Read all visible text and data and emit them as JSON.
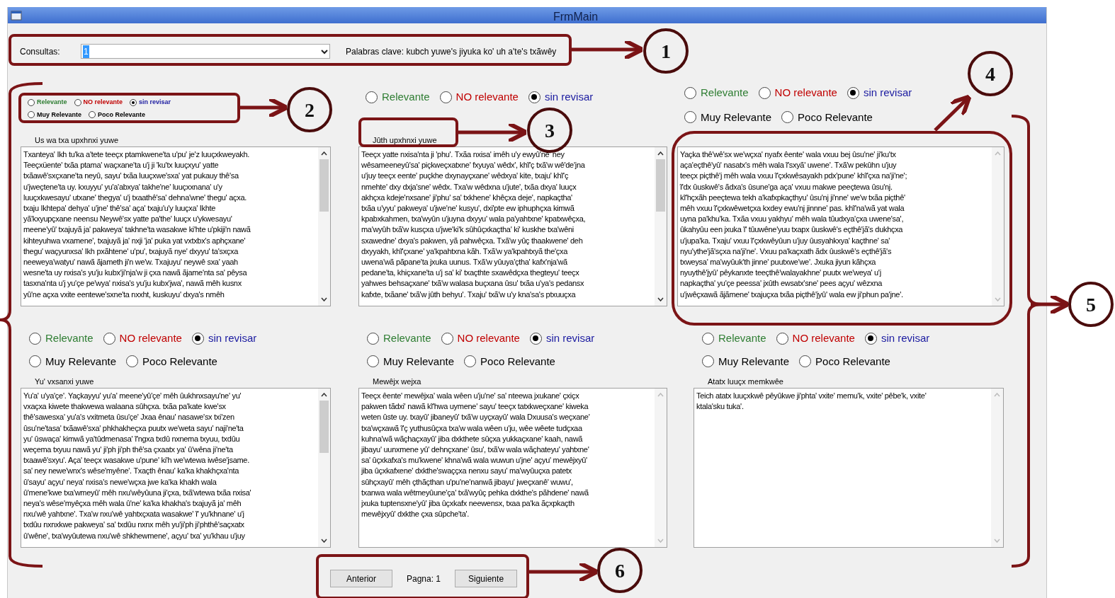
{
  "window": {
    "title": "FrmMain"
  },
  "query": {
    "label": "Consultas:",
    "value": "1",
    "keywords": "Palabras clave: kubch yuwe's jiyuka ko' uh a'te's txãwêy"
  },
  "panels": [
    {
      "kind": "compact",
      "options": [
        [
          {
            "label": "Relevante",
            "color": "#2e7d32",
            "selected": false
          },
          {
            "label": "NO relevante",
            "color": "#c00000",
            "selected": false
          },
          {
            "label": "sin revisar",
            "color": "#1a1aa0",
            "selected": true
          }
        ],
        [
          {
            "label": "Muy Relevante",
            "color": "#000000",
            "selected": false
          },
          {
            "label": "Poco Relevante",
            "color": "#000000",
            "selected": false
          }
        ]
      ],
      "title": "Us wa txa upxhnxi yuwe",
      "scrollable": true,
      "lines": [
        "Txanteya' Ikh tu'ka a'tete teeçx ptamkwene'ta u'pu' je'z luuçxkweyakh.",
        "Teeçxüente' txãa ptama' waçxane'ta u'j ji 'ku'tx luuçxyu' yatte",
        "txãawê'sxçxane'ta neyû, sayu' txãa luuçxwe'sxa' yat pukauy thê'sa",
        "u'jweçtene'ta uy. kxuyyu' yu'a'abxya' takhe'ne' luuçxxnana' u'y",
        "luuçxkwesayu' utxane' thegya' u'j txaathê'sa' dehna'wne' thegu' açxa.",
        "txaju Ikhtepa' dehya' u'jne' thê'sa' aça' txaju'u'y luuçxa' Ikhte",
        "yã'kxyupçxane neensu Neywê'sx yatte pa'the' luuçx u'ykwesayu'",
        "meene'yû' txajuyã ja' pakweya' takhne'ta wasakwe ki'hte u'pkiji'n nawã",
        "kihteyuhwa vxamene', txajuyã ja' nxji 'ja' puka yat vxtxbx's aphçxane'",
        "thegu' waçyunxsa' Ikh pxãhtene' u'pu', txajuyã nye' dxyyu' ta'sxçxa",
        "neeweya'watyu' nawã ãjameth ji'n we'w. Txajuyu' neywê sxa' yaah",
        "wesne'ta uy nxisa's yu'ju kubx'ji'nja'w ji çxa nawã ãjame'nta sa' pêysa",
        "tasxna'nta u'j yu'çe pe'wya' nxisa's yu'ju kubx'jwa', nawã mêh kusnx",
        "yû'ne açxa vxite eentewe'sxne'ta nxxht, kuskuyu' dxya's nmêh"
      ]
    },
    {
      "kind": "normal",
      "options": [
        [
          {
            "label": "Relevante",
            "color": "#2e7d32",
            "selected": false
          },
          {
            "label": "NO relevante",
            "color": "#c00000",
            "selected": false
          },
          {
            "label": "sin revisar",
            "color": "#1a1aa0",
            "selected": true
          }
        ]
      ],
      "title": "Jûth upxhnxi yuwe",
      "scrollable": true,
      "lines": [
        "Teeçx yatte nxisa'nta ji 'phu'. Txãa nxisa' imêh u'y ewyû'ne' ney",
        "wêsameeneyû'sa' piçkweçxatxne' fxyuya' wêdx', khĩ'ç txã'w wê'de'jna",
        "u'juy teeçx eente' puçkhe dxynayçxane' wêdxya' kite, txaju' khĩ'ç",
        "nmehte' dxy dxja'sne' wêdx. Txa'w wêdxna u'jute', txãa dxya' luuçx",
        "akhçxa kdeje'nxsane' ji'phu' sa' txkhene' khêçxa deje', napkaçtha'",
        "txãa u'yyu' pakweya' u'jwe'ne' kusyu', dxi'pte ew iphuphçxa kimwã",
        "kpabxkahmen, txa'wyûn u'juyna dxyyu' wala pa'yahtxne' kpatxwêçxa,",
        "ma'wyûh txã'w kusçxa u'jwe'ki'k sûhûçxkaçtha' ki' kuskhe txa'wêni",
        "sxawedne' dxya's pakwen, yã pahwêçxa. Txã'w yûç thaakwene' deh",
        "dxyyakh, khĩ'çxane' ya'kpahtxna kãh. Txã'w ya'kpahtxyã the'çxa",
        "uwena'wã pãpane'ta jxuka uunus. Txã'w yûuya'çtha' kafx'nja'wã",
        "pedane'ta, khiçxane'ta u'j sa' ki' txaçthte sxawêdçxa thegteyu' teeçx",
        "yahwes behsaçxane' txã'w walasa buçxana ûsu' txãa u'ya's pedansx",
        "kafxte, txãane' txã'w jûth behyu'. Txaju' txã'w u'y kna'sa's ptxuuçxa"
      ]
    },
    {
      "kind": "normal",
      "options": [
        [
          {
            "label": "Relevante",
            "color": "#2e7d32",
            "selected": false
          },
          {
            "label": "NO relevante",
            "color": "#c00000",
            "selected": false
          },
          {
            "label": "sin revisar",
            "color": "#1a1aa0",
            "selected": true
          }
        ],
        [
          {
            "label": "Muy Relevante",
            "color": "#000000",
            "selected": false
          },
          {
            "label": "Poco Relevante",
            "color": "#000000",
            "selected": false
          }
        ]
      ],
      "scrollable": false,
      "lines": [
        "Yaçka thê'wê'sx we'wçxa' nyafx êente' wala vxuu bej ûsu'ne' ji'ku'tx",
        "aça'eçthê'yû' nasatx's mêh wala ĩ'sxyã' uwene'. Txã'w pekûhn u'juy",
        "teeçx piçthê'j mêh wala vxuu ĩ'çxkwêsayakh pdx'pune' khĩ'çxa na'ji'ne';",
        "ĩ'dx ûuskwê's ãdxa's ûsune'ga aça' vxuu makwe peeçtewa ûsu'nj.",
        "kĩ'hçxãh peeçtewa tekh a'kafxpkaçthyu' ûsu'nj ji'nne' we'w txãa piçthê'",
        "mêh vxuu ĩ'çxkwêwetçxa kxdey ewu'nj jinnne' pas. khĩ'na'wã yat wala",
        "uyna pa'khu'ka. Txãa vxuu yakhyu' mêh wala tûudxya'çxa uwene'sa',",
        "ûkahyûu een jxuka ĩ' tûuwêne'yuu txapx ûuskwê's eçthê'jã's dukhçxa",
        "u'jupa'ka. Txaju' vxuu ĩ'çxkwêyûun u'juy ûusyahkxya' kaçthne' sa'",
        "nyu'ythe'jã'sçxa na'ji'ne'. Vxuu pa'kaçxath ãdx ûuskwê's eçthê'jã's",
        "txweysa' ma'wyûuk'th jinne' puutxwe'we'. Jxuka jiyun kãhçxa",
        "nyuythê'jyû' pêykanxte teeçthê'walayakhne' puutx we'weya' u'j",
        "napkaçtha' yu'çe peessa' jxûth ewsatx'sne' pees açyu' wêzxna",
        "u'jwêçxawã ãjãmene' txajuçxa txãa piçthê'jyû' wala ew ji'phun pa'jne'."
      ]
    },
    {
      "kind": "normal",
      "options": [
        [
          {
            "label": "Relevante",
            "color": "#2e7d32",
            "selected": false
          },
          {
            "label": "NO relevante",
            "color": "#c00000",
            "selected": false
          },
          {
            "label": "sin revisar",
            "color": "#1a1aa0",
            "selected": true
          }
        ],
        [
          {
            "label": "Muy Relevante",
            "color": "#000000",
            "selected": false
          },
          {
            "label": "Poco Relevante",
            "color": "#000000",
            "selected": false
          }
        ]
      ],
      "title": "Yu' vxsanxi yuwe",
      "scrollable": true,
      "lines": [
        "Yu'a' u'ya'çe'. Yaçkayyu' yu'a' meene'yû'çe' mêh ûukhnxsayu'ne' yu'",
        "vxaçxa kiwete thakwewa walaana sûhçxa. txãa pa'kate kwe'sx",
        "thê'sawesxa' yu'a's vxitmeta ûsu'çe' Jxaa ênau' nasawe'sx txi'zen",
        "ûsu'ne'tasa' txãawê'sxa' phkhakheçxa puutx we'weta sayu' naji'ne'ta",
        "yu' ûswaça' kimwã ya'tûdmenasa' ĩ'ngxa txdû nxnema txyuu, txdûu",
        "weçema txyuu nawã yu' ji'ph ji'ph thê'sa çxaatx ya' û'wêna ji'ne'ta",
        "txaawê'sxyu'. Aça' teeçx wasakwe u'pune' ki'h we'wtewa iwêse'jsame.",
        "sa' ney newe'wnx's wêse'myêne'. Txaçth ênau' ka'ka khakhçxa'nta",
        "û'sayu' açyu' neya' nxisa's newe'wçxa jwe ka'ka khakh wala",
        "û'mene'kwe txa'wmeyû' mêh nxu'wêyûuna ji'çxa, txã'wtewa txãa nxisa'",
        "neya's wêse'myêçxa mêh wala û'ne' ka'ka khakha's txajuyã ja' mêh",
        "nxu'wê yahtxne'. Txa'w nxu'wê yahtxçxata wasakwe' ĩ' yu'khnane' u'j",
        "txdûu nxnxkwe pakweya' sa' txdûu nxnx mêh yu'ji'ph ji'phthê'saçxatx",
        "û'wêne', txa'wyûutewa nxu'wê shkhewmene', açyu' txa' yu'khau u'juy"
      ]
    },
    {
      "kind": "normal",
      "options": [
        [
          {
            "label": "Relevante",
            "color": "#2e7d32",
            "selected": false
          },
          {
            "label": "NO relevante",
            "color": "#c00000",
            "selected": false
          },
          {
            "label": "sin revisar",
            "color": "#1a1aa0",
            "selected": true
          }
        ],
        [
          {
            "label": "Muy Relevante",
            "color": "#000000",
            "selected": false
          },
          {
            "label": "Poco Relevante",
            "color": "#000000",
            "selected": false
          }
        ]
      ],
      "title": "Mewêjx wejxa",
      "scrollable": false,
      "lines": [
        "Teeçx êente' mewêjxa' wala wêen u'ju'ne' sa' nteewa jxukane' çxiçx",
        "pakwen tãdxi' nawã kĩ'hwa uymene' sayu' teeçx tatxkweçxane' kiweka",
        "weten ûste uy. txayû' jibaneyû' txã'w uyçxayû' wala Dxuusa's weçxane'",
        "txa'wçxawã ĩ'ç yuthusûçxa txa'w wala wêen u'ju, wêe wêete tudçxaa",
        "kuhna'wã wãçhaçxayû' jiba dxkthete sûçxa yukkaçxane' kaah, nawã",
        "jibayu' uunxmene yû' dehnçxane' ûsu', txã'w wala wãçhateyu' yahtxne'",
        "sa' ûçxkafxa's mu'kwene' khna'wã wala wuwun u'jne' açyu' mewêjxyû'",
        "jiba ûçxkafxene' dxkthe'swaççxa nenxu sayu' ma'wyûuçxa patetx",
        "sûhçxayû' mêh çthãçthan u'pu'ne'nanwã jibayu' jweçxanê' wuwu',",
        "txanwa wala wêtmeyûune'ça' txã'wyûç pehka dxkthe's pãhdene' nawã",
        "jxuka tuptensxne'yû' jiba ûçxkafx neewensx, txaa pa'ka ãçxpkaçth",
        "mewêjxyû' dxkthe çxa sûpche'ta'."
      ]
    },
    {
      "kind": "normal",
      "options": [
        [
          {
            "label": "Relevante",
            "color": "#2e7d32",
            "selected": false
          },
          {
            "label": "NO relevante",
            "color": "#c00000",
            "selected": false
          },
          {
            "label": "sin revisar",
            "color": "#1a1aa0",
            "selected": true
          }
        ],
        [
          {
            "label": "Muy Relevante",
            "color": "#000000",
            "selected": false
          },
          {
            "label": "Poco Relevante",
            "color": "#000000",
            "selected": false
          }
        ]
      ],
      "title": "Atatx luuçx memkwêe",
      "scrollable": false,
      "lines": [
        "Teich atatx luuçxkwê pêyûkwe ji'phta' vxite' memu'k, vxite' pêbe'k, vxite'",
        "ktala'sku tuka'."
      ]
    }
  ],
  "pager": {
    "previous": "Anterior",
    "page": "Pagna: 1",
    "next": "Siguiente"
  },
  "annotations": [
    "1",
    "2",
    "3",
    "4",
    "5",
    "6"
  ]
}
